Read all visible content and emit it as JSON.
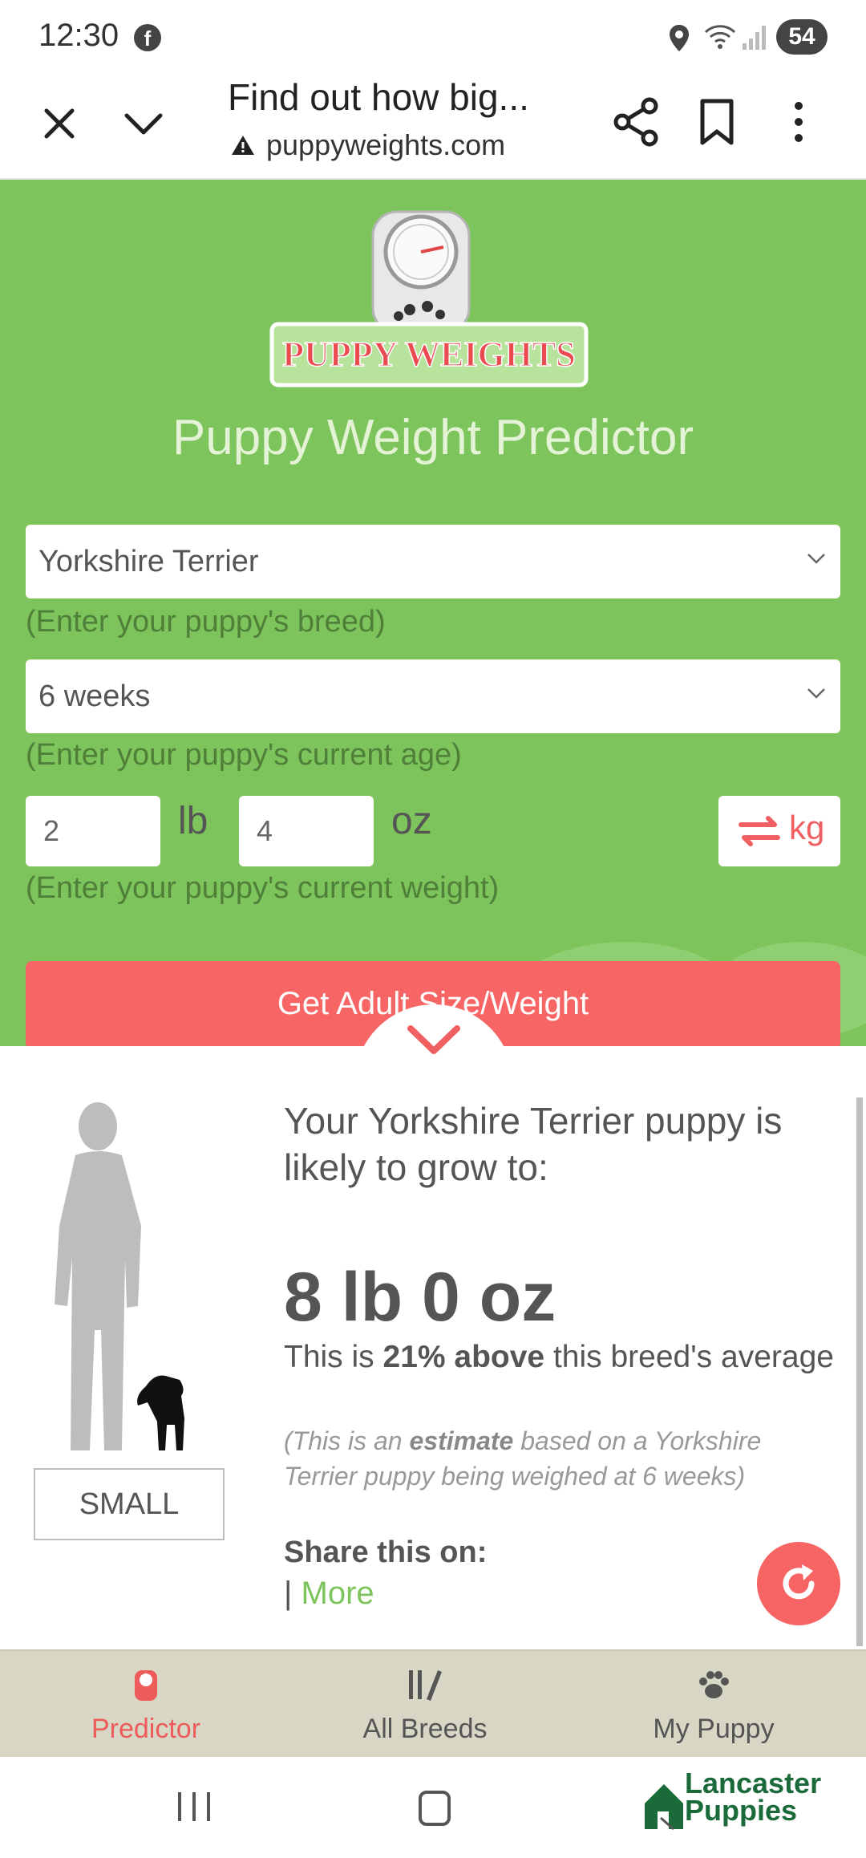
{
  "status_bar": {
    "time": "12:30",
    "facebook_glyph": "f",
    "battery": "54"
  },
  "browser": {
    "title": "Find out how big...",
    "url": "puppyweights.com",
    "icons": [
      "close-icon",
      "chevron-down-icon",
      "share-icon",
      "bookmark-icon",
      "more-vert-icon",
      "warning-icon"
    ]
  },
  "predictor": {
    "logo_text": "PUPPY WEIGHTS",
    "heading": "Puppy Weight Predictor",
    "breed": {
      "value": "Yorkshire Terrier",
      "hint": "(Enter your puppy's breed)"
    },
    "age": {
      "value": "6 weeks",
      "hint": "(Enter your puppy's current age)"
    },
    "weight": {
      "lb_value": "2",
      "lb_unit": "lb",
      "oz_value": "4",
      "oz_unit": "oz",
      "toggle_unit": "kg",
      "hint": "(Enter your puppy's current weight)"
    },
    "submit_label": "Get Adult Size/Weight"
  },
  "result": {
    "intro": "Your Yorkshire Terrier puppy is likely to grow to:",
    "weight": "8 lb 0 oz",
    "compare_prefix": "This is ",
    "compare_bold": "21% above",
    "compare_suffix": " this breed's average",
    "note_prefix": "(This is an ",
    "note_bold": "estimate",
    "note_suffix": " based on a Yorkshire Terrier puppy being weighed at 6 weeks)",
    "size_label": "SMALL",
    "share_heading": "Share this on:",
    "share_separator": "|",
    "share_more": "More"
  },
  "bottom_nav": {
    "items": [
      {
        "label": "Predictor",
        "icon": "scale-icon",
        "active": true
      },
      {
        "label": "All Breeds",
        "icon": "breeds-icon",
        "active": false
      },
      {
        "label": "My Puppy",
        "icon": "paw-icon",
        "active": false
      }
    ]
  },
  "system_nav": {
    "brand_line1": "Lancaster",
    "brand_line2": "Puppies"
  },
  "colors": {
    "green": "#7dc45c",
    "red": "#f76565",
    "nav_bg": "#d8d6c4"
  }
}
